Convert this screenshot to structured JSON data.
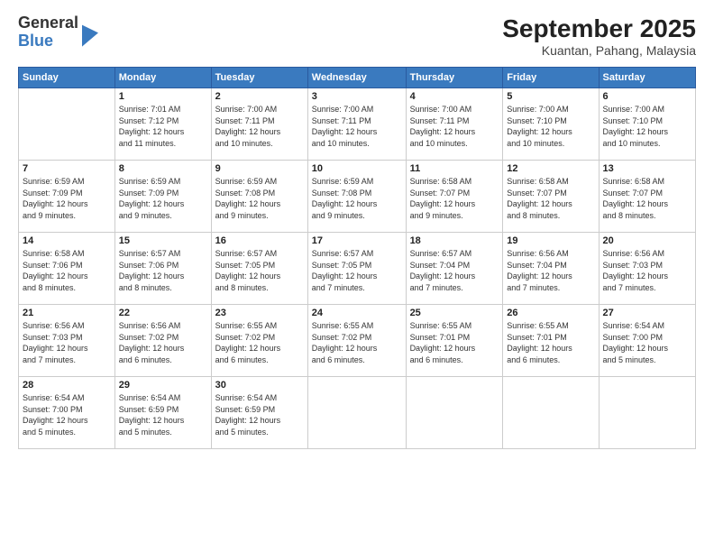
{
  "logo": {
    "line1": "General",
    "line2": "Blue"
  },
  "title": "September 2025",
  "subtitle": "Kuantan, Pahang, Malaysia",
  "days_of_week": [
    "Sunday",
    "Monday",
    "Tuesday",
    "Wednesday",
    "Thursday",
    "Friday",
    "Saturday"
  ],
  "weeks": [
    [
      {
        "day": "",
        "info": ""
      },
      {
        "day": "1",
        "info": "Sunrise: 7:01 AM\nSunset: 7:12 PM\nDaylight: 12 hours\nand 11 minutes."
      },
      {
        "day": "2",
        "info": "Sunrise: 7:00 AM\nSunset: 7:11 PM\nDaylight: 12 hours\nand 10 minutes."
      },
      {
        "day": "3",
        "info": "Sunrise: 7:00 AM\nSunset: 7:11 PM\nDaylight: 12 hours\nand 10 minutes."
      },
      {
        "day": "4",
        "info": "Sunrise: 7:00 AM\nSunset: 7:11 PM\nDaylight: 12 hours\nand 10 minutes."
      },
      {
        "day": "5",
        "info": "Sunrise: 7:00 AM\nSunset: 7:10 PM\nDaylight: 12 hours\nand 10 minutes."
      },
      {
        "day": "6",
        "info": "Sunrise: 7:00 AM\nSunset: 7:10 PM\nDaylight: 12 hours\nand 10 minutes."
      }
    ],
    [
      {
        "day": "7",
        "info": "Sunrise: 6:59 AM\nSunset: 7:09 PM\nDaylight: 12 hours\nand 9 minutes."
      },
      {
        "day": "8",
        "info": "Sunrise: 6:59 AM\nSunset: 7:09 PM\nDaylight: 12 hours\nand 9 minutes."
      },
      {
        "day": "9",
        "info": "Sunrise: 6:59 AM\nSunset: 7:08 PM\nDaylight: 12 hours\nand 9 minutes."
      },
      {
        "day": "10",
        "info": "Sunrise: 6:59 AM\nSunset: 7:08 PM\nDaylight: 12 hours\nand 9 minutes."
      },
      {
        "day": "11",
        "info": "Sunrise: 6:58 AM\nSunset: 7:07 PM\nDaylight: 12 hours\nand 9 minutes."
      },
      {
        "day": "12",
        "info": "Sunrise: 6:58 AM\nSunset: 7:07 PM\nDaylight: 12 hours\nand 8 minutes."
      },
      {
        "day": "13",
        "info": "Sunrise: 6:58 AM\nSunset: 7:07 PM\nDaylight: 12 hours\nand 8 minutes."
      }
    ],
    [
      {
        "day": "14",
        "info": "Sunrise: 6:58 AM\nSunset: 7:06 PM\nDaylight: 12 hours\nand 8 minutes."
      },
      {
        "day": "15",
        "info": "Sunrise: 6:57 AM\nSunset: 7:06 PM\nDaylight: 12 hours\nand 8 minutes."
      },
      {
        "day": "16",
        "info": "Sunrise: 6:57 AM\nSunset: 7:05 PM\nDaylight: 12 hours\nand 8 minutes."
      },
      {
        "day": "17",
        "info": "Sunrise: 6:57 AM\nSunset: 7:05 PM\nDaylight: 12 hours\nand 7 minutes."
      },
      {
        "day": "18",
        "info": "Sunrise: 6:57 AM\nSunset: 7:04 PM\nDaylight: 12 hours\nand 7 minutes."
      },
      {
        "day": "19",
        "info": "Sunrise: 6:56 AM\nSunset: 7:04 PM\nDaylight: 12 hours\nand 7 minutes."
      },
      {
        "day": "20",
        "info": "Sunrise: 6:56 AM\nSunset: 7:03 PM\nDaylight: 12 hours\nand 7 minutes."
      }
    ],
    [
      {
        "day": "21",
        "info": "Sunrise: 6:56 AM\nSunset: 7:03 PM\nDaylight: 12 hours\nand 7 minutes."
      },
      {
        "day": "22",
        "info": "Sunrise: 6:56 AM\nSunset: 7:02 PM\nDaylight: 12 hours\nand 6 minutes."
      },
      {
        "day": "23",
        "info": "Sunrise: 6:55 AM\nSunset: 7:02 PM\nDaylight: 12 hours\nand 6 minutes."
      },
      {
        "day": "24",
        "info": "Sunrise: 6:55 AM\nSunset: 7:02 PM\nDaylight: 12 hours\nand 6 minutes."
      },
      {
        "day": "25",
        "info": "Sunrise: 6:55 AM\nSunset: 7:01 PM\nDaylight: 12 hours\nand 6 minutes."
      },
      {
        "day": "26",
        "info": "Sunrise: 6:55 AM\nSunset: 7:01 PM\nDaylight: 12 hours\nand 6 minutes."
      },
      {
        "day": "27",
        "info": "Sunrise: 6:54 AM\nSunset: 7:00 PM\nDaylight: 12 hours\nand 5 minutes."
      }
    ],
    [
      {
        "day": "28",
        "info": "Sunrise: 6:54 AM\nSunset: 7:00 PM\nDaylight: 12 hours\nand 5 minutes."
      },
      {
        "day": "29",
        "info": "Sunrise: 6:54 AM\nSunset: 6:59 PM\nDaylight: 12 hours\nand 5 minutes."
      },
      {
        "day": "30",
        "info": "Sunrise: 6:54 AM\nSunset: 6:59 PM\nDaylight: 12 hours\nand 5 minutes."
      },
      {
        "day": "",
        "info": ""
      },
      {
        "day": "",
        "info": ""
      },
      {
        "day": "",
        "info": ""
      },
      {
        "day": "",
        "info": ""
      }
    ]
  ]
}
